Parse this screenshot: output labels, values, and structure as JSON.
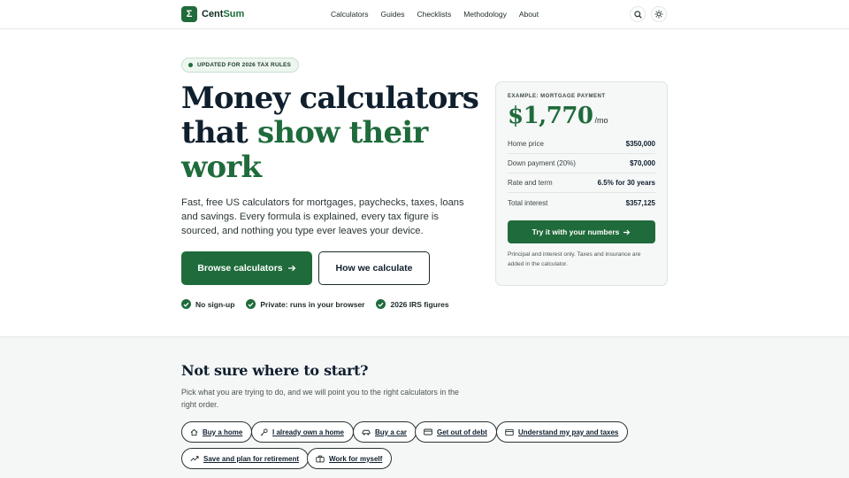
{
  "header": {
    "brand_left": "Cent",
    "brand_right": "Sum",
    "logo_glyph": "Σ",
    "nav": [
      "Calculators",
      "Guides",
      "Checklists",
      "Methodology",
      "About"
    ],
    "icons": [
      "search-icon",
      "sun-icon"
    ]
  },
  "hero": {
    "badge": "UPDATED FOR 2026 TAX RULES",
    "title_line1": "Money calculators",
    "title_that": "that ",
    "title_green1": "show their",
    "title_green2": "work",
    "description": "Fast, free US calculators for mortgages, paychecks, taxes, loans and savings. Every formula is explained, every tax figure is sourced, and nothing you type ever leaves your device.",
    "primary_button": "Browse calculators",
    "secondary_button": "How we calculate",
    "trust": [
      "No sign-up",
      "Private: runs in your browser",
      "2026 IRS figures"
    ]
  },
  "example_card": {
    "label": "EXAMPLE: MORTGAGE PAYMENT",
    "amount": "$1,770",
    "unit": "/mo",
    "rows": [
      {
        "k": "Home price",
        "v": "$350,000"
      },
      {
        "k": "Down payment (20%)",
        "v": "$70,000"
      },
      {
        "k": "Rate and term",
        "v": "6.5% for 30 years"
      },
      {
        "k": "Total interest",
        "v": "$357,125"
      }
    ],
    "button": "Try it with your numbers",
    "note": "Principal and interest only. Taxes and insurance are added in the calculator."
  },
  "start": {
    "title": "Not sure where to start?",
    "description": "Pick what you are trying to do, and we will point you to the right calculators in the right order.",
    "chips": [
      {
        "label": "Buy a home",
        "icon": "home-icon"
      },
      {
        "label": "I already own a home",
        "icon": "key-icon"
      },
      {
        "label": "Buy a car",
        "icon": "car-icon"
      },
      {
        "label": "Get out of debt",
        "icon": "card-icon"
      },
      {
        "label": "Understand my pay and taxes",
        "icon": "wallet-icon"
      },
      {
        "label": "Save and plan for retirement",
        "icon": "trend-icon"
      },
      {
        "label": "Work for myself",
        "icon": "briefcase-icon"
      }
    ]
  },
  "colors": {
    "brand_green": "#1f6b3b",
    "ink": "#0f1f2e",
    "panel": "#f6f7f7"
  }
}
